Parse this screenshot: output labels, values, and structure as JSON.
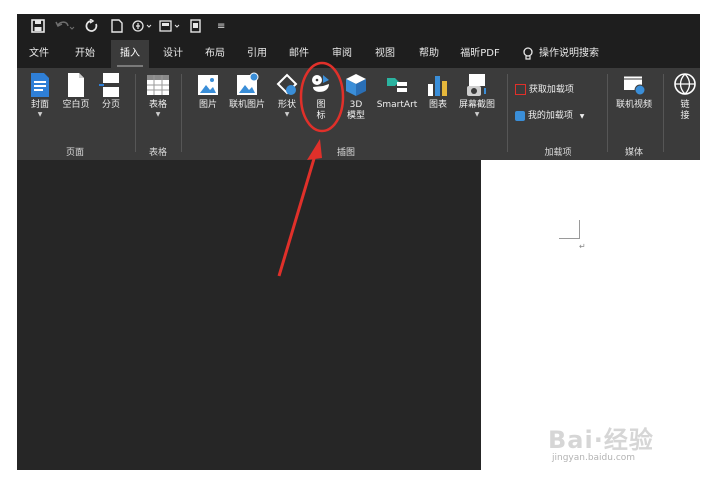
{
  "quick_access": {
    "save_icon": "save-icon",
    "undo_icon": "undo-icon",
    "redo_icon": "redo-icon",
    "new_icon": "new-doc-icon",
    "touch_icon": "touch-mode-icon",
    "more_label": "≡"
  },
  "tabs": [
    {
      "label": "文件"
    },
    {
      "label": "开始"
    },
    {
      "label": "插入",
      "active": true
    },
    {
      "label": "设计"
    },
    {
      "label": "布局"
    },
    {
      "label": "引用"
    },
    {
      "label": "邮件"
    },
    {
      "label": "审阅"
    },
    {
      "label": "视图"
    },
    {
      "label": "帮助"
    },
    {
      "label": "福昕PDF"
    },
    {
      "label": "操作说明搜索"
    }
  ],
  "ribbon": {
    "pages": {
      "cover": "封面",
      "blank": "空白页",
      "break": "分页",
      "group": "页面"
    },
    "table": {
      "label": "表格",
      "group": "表格"
    },
    "illustrations": {
      "picture": "图片",
      "online_picture": "联机图片",
      "shapes": "形状",
      "icons_line1": "图",
      "icons_line2": "标",
      "model_line1": "3D",
      "model_line2": "模型",
      "smartart": "SmartArt",
      "chart": "图表",
      "screenshot": "屏幕截图",
      "group": "插图"
    },
    "addins": {
      "get": "获取加载项",
      "my": "我的加载项",
      "group": "加载项"
    },
    "media": {
      "video": "联机视频",
      "group": "媒体"
    },
    "links": {
      "line1": "链",
      "line2": "接"
    }
  },
  "document": {
    "paragraph_mark": "↵"
  },
  "watermark": {
    "main": "Bai·经验",
    "sub": "jingyan.baidu.com"
  },
  "colors": {
    "annotation_red": "#e0302a",
    "ribbon_bg": "#3b3b3b",
    "tab_bg": "#1e1e1e"
  }
}
